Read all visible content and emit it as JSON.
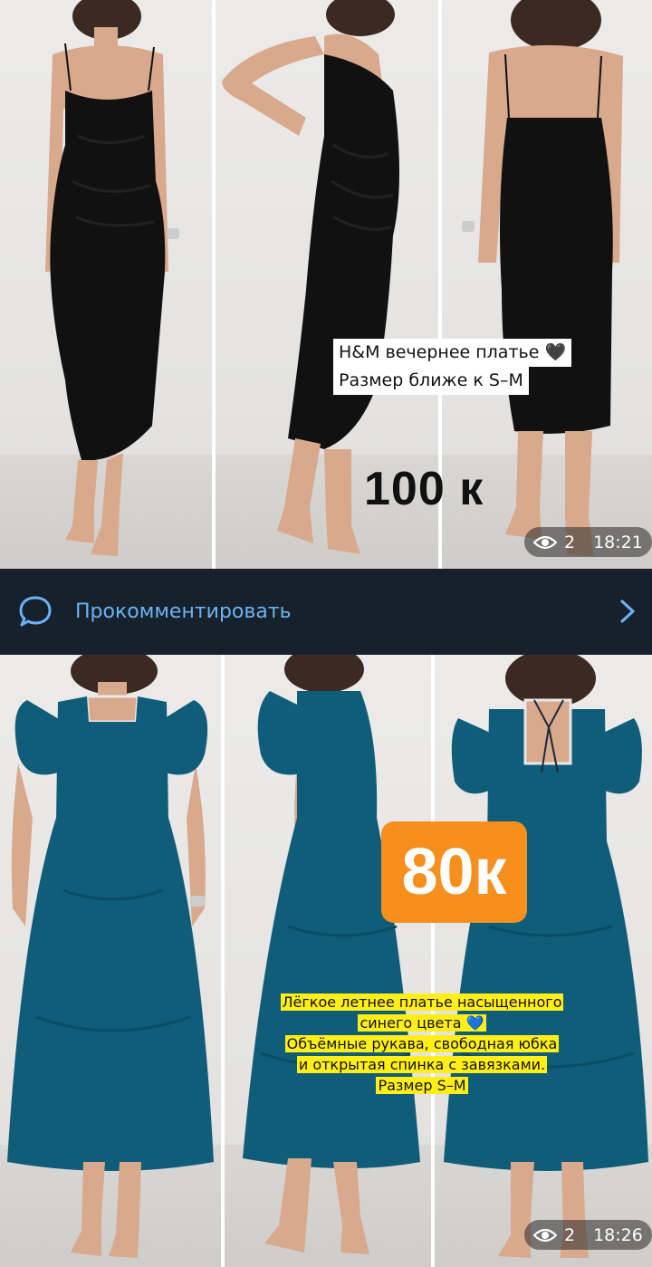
{
  "post1": {
    "caption_line1": "H&M вечернее платье 🖤",
    "caption_line2": "Размер ближе к S–M",
    "price": "100 к",
    "views": "2",
    "time": "18:21",
    "photos": [
      "black-dress-front",
      "black-dress-side",
      "black-dress-back"
    ]
  },
  "comment_bar": {
    "label": "Прокомментировать",
    "icon": "chat-bubble-icon",
    "chevron": "chevron-right-icon"
  },
  "post2": {
    "price": "80к",
    "caption_lines": [
      "Лёгкое летнее платье насыщенного",
      "синего цвета 💙",
      "Объёмные рукава, свободная юбка",
      "и открытая спинка с завязками.",
      "Размер S–M"
    ],
    "views": "2",
    "time": "18:26",
    "photos": [
      "blue-dress-front",
      "blue-dress-side",
      "blue-dress-back"
    ]
  },
  "colors": {
    "background": "#17212b",
    "link": "#6ab3f3",
    "price_badge": "#f78f1e",
    "caption_highlight": "#ffef17",
    "black_dress": "#111111",
    "blue_dress": "#0f5d78"
  }
}
